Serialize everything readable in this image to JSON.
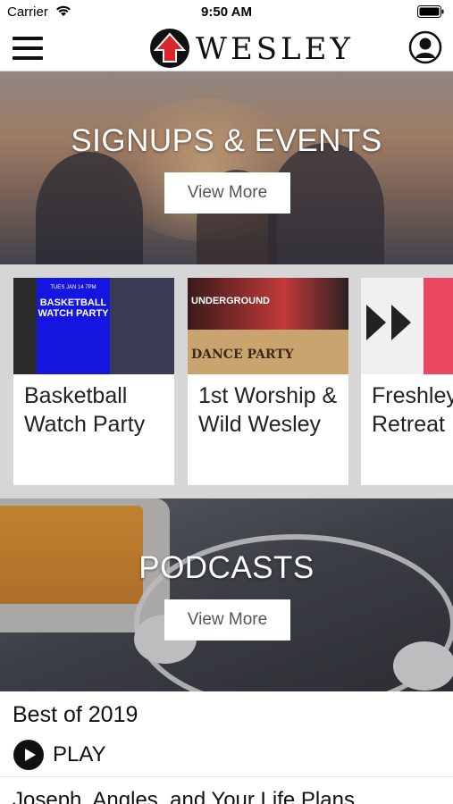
{
  "status_bar": {
    "carrier": "Carrier",
    "time": "9:50 AM"
  },
  "nav": {
    "logo_text": "WESLEY"
  },
  "events_section": {
    "title": "SIGNUPS & EVENTS",
    "button_label": "View More"
  },
  "events": [
    {
      "title": "Basketball Watch Party",
      "thumb_top": "TUES JAN 14  7PM",
      "thumb_title": "BASKETBALL WATCH PARTY"
    },
    {
      "title": "1st Worship & Wild Wesley",
      "thumb_top": "UNDERGROUND",
      "thumb_title": "DANCE PARTY"
    },
    {
      "title": "Freshley Retreat"
    }
  ],
  "podcasts_section": {
    "title": "PODCASTS",
    "button_label": "View More"
  },
  "podcasts": [
    {
      "title": "Best of 2019",
      "play_label": "PLAY"
    },
    {
      "title": "Joseph, Angles, and Your Life Plans"
    }
  ],
  "colors": {
    "accent_red": "#d9262c",
    "card_bg": "#ffffff",
    "carousel_bg": "#d6d6d6"
  }
}
